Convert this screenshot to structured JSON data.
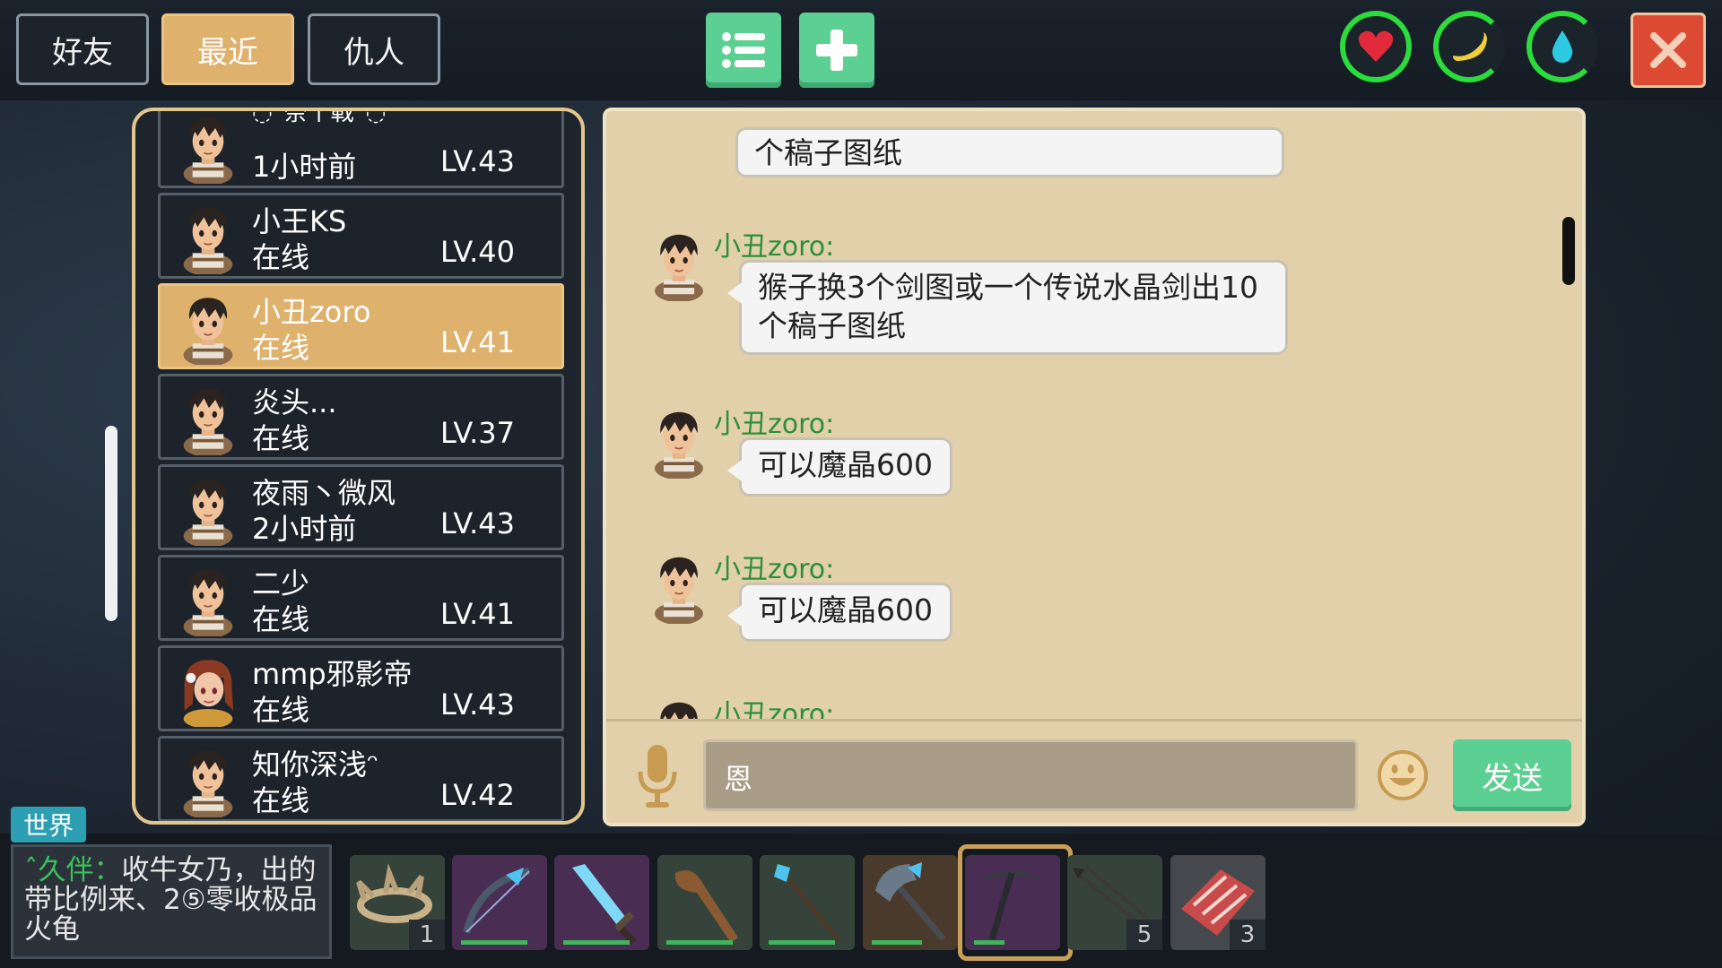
{
  "tabs": [
    {
      "label": "好友",
      "active": false
    },
    {
      "label": "最近",
      "active": true
    },
    {
      "label": "仇人",
      "active": false
    }
  ],
  "toolbar": {
    "list_icon": "list-icon",
    "add_icon": "plus-icon"
  },
  "status": {
    "health_icon": "heart-icon",
    "hunger_icon": "banana-icon",
    "thirst_icon": "water-drop-icon",
    "close_icon": "close-icon"
  },
  "friends": [
    {
      "name": "◌°奈丨戰°◌",
      "status": "1小时前",
      "level": "LV.43",
      "avatar": "boy-avatar",
      "selected": false
    },
    {
      "name": "小王KS",
      "status": "在线",
      "level": "LV.40",
      "avatar": "boy-avatar",
      "selected": false
    },
    {
      "name": "小丑zoro",
      "status": "在线",
      "level": "LV.41",
      "avatar": "boy-avatar",
      "selected": true
    },
    {
      "name": "炎头...",
      "status": "在线",
      "level": "LV.37",
      "avatar": "boy-avatar",
      "selected": false
    },
    {
      "name": "夜雨丶微风",
      "status": "2小时前",
      "level": "LV.43",
      "avatar": "boy-avatar",
      "selected": false
    },
    {
      "name": "二少",
      "status": "在线",
      "level": "LV.41",
      "avatar": "boy-avatar",
      "selected": false
    },
    {
      "name": "mmp邪影帝",
      "status": "在线",
      "level": "LV.43",
      "avatar": "girl-avatar",
      "selected": false
    },
    {
      "name": "知你深浅ᵔ",
      "status": "在线",
      "level": "LV.42",
      "avatar": "boy-avatar",
      "selected": false
    }
  ],
  "chat": {
    "messages": [
      {
        "sender": "",
        "lines": [
          "个稿子图纸"
        ]
      },
      {
        "sender": "小丑zoro:",
        "lines": [
          "猴子换3个剑图或一个传说水晶剑出10",
          "个稿子图纸"
        ]
      },
      {
        "sender": "小丑zoro:",
        "lines": [
          "可以魔晶600"
        ]
      },
      {
        "sender": "小丑zoro:",
        "lines": [
          "可以魔晶600"
        ]
      },
      {
        "sender": "小丑zoro:",
        "lines": []
      }
    ],
    "input_value": "恩",
    "mic_icon": "microphone-icon",
    "emoji_icon": "smiley-icon",
    "send_label": "发送"
  },
  "world": {
    "tag": "世界",
    "speaker": "ˆ久伴：",
    "text": "收牛女乃，出的带比例来、2⑤零收极品火龟"
  },
  "hotbar": [
    {
      "item": "thorn-crown-icon",
      "count": "1",
      "durability": null
    },
    {
      "item": "crystal-bow-icon",
      "count": "",
      "durability": 1.0
    },
    {
      "item": "crystal-sword-icon",
      "count": "",
      "durability": 1.0
    },
    {
      "item": "wooden-club-icon",
      "count": "",
      "durability": 1.0
    },
    {
      "item": "crystal-staff-icon",
      "count": "",
      "durability": 1.0
    },
    {
      "item": "crystal-axe-icon",
      "count": "",
      "durability": 0.75
    },
    {
      "item": "pickaxe-icon",
      "count": "",
      "durability": 0.45,
      "selected": true
    },
    {
      "item": "arrows-icon",
      "count": "5",
      "durability": null
    },
    {
      "item": "raw-meat-icon",
      "count": "3",
      "durability": null
    }
  ]
}
